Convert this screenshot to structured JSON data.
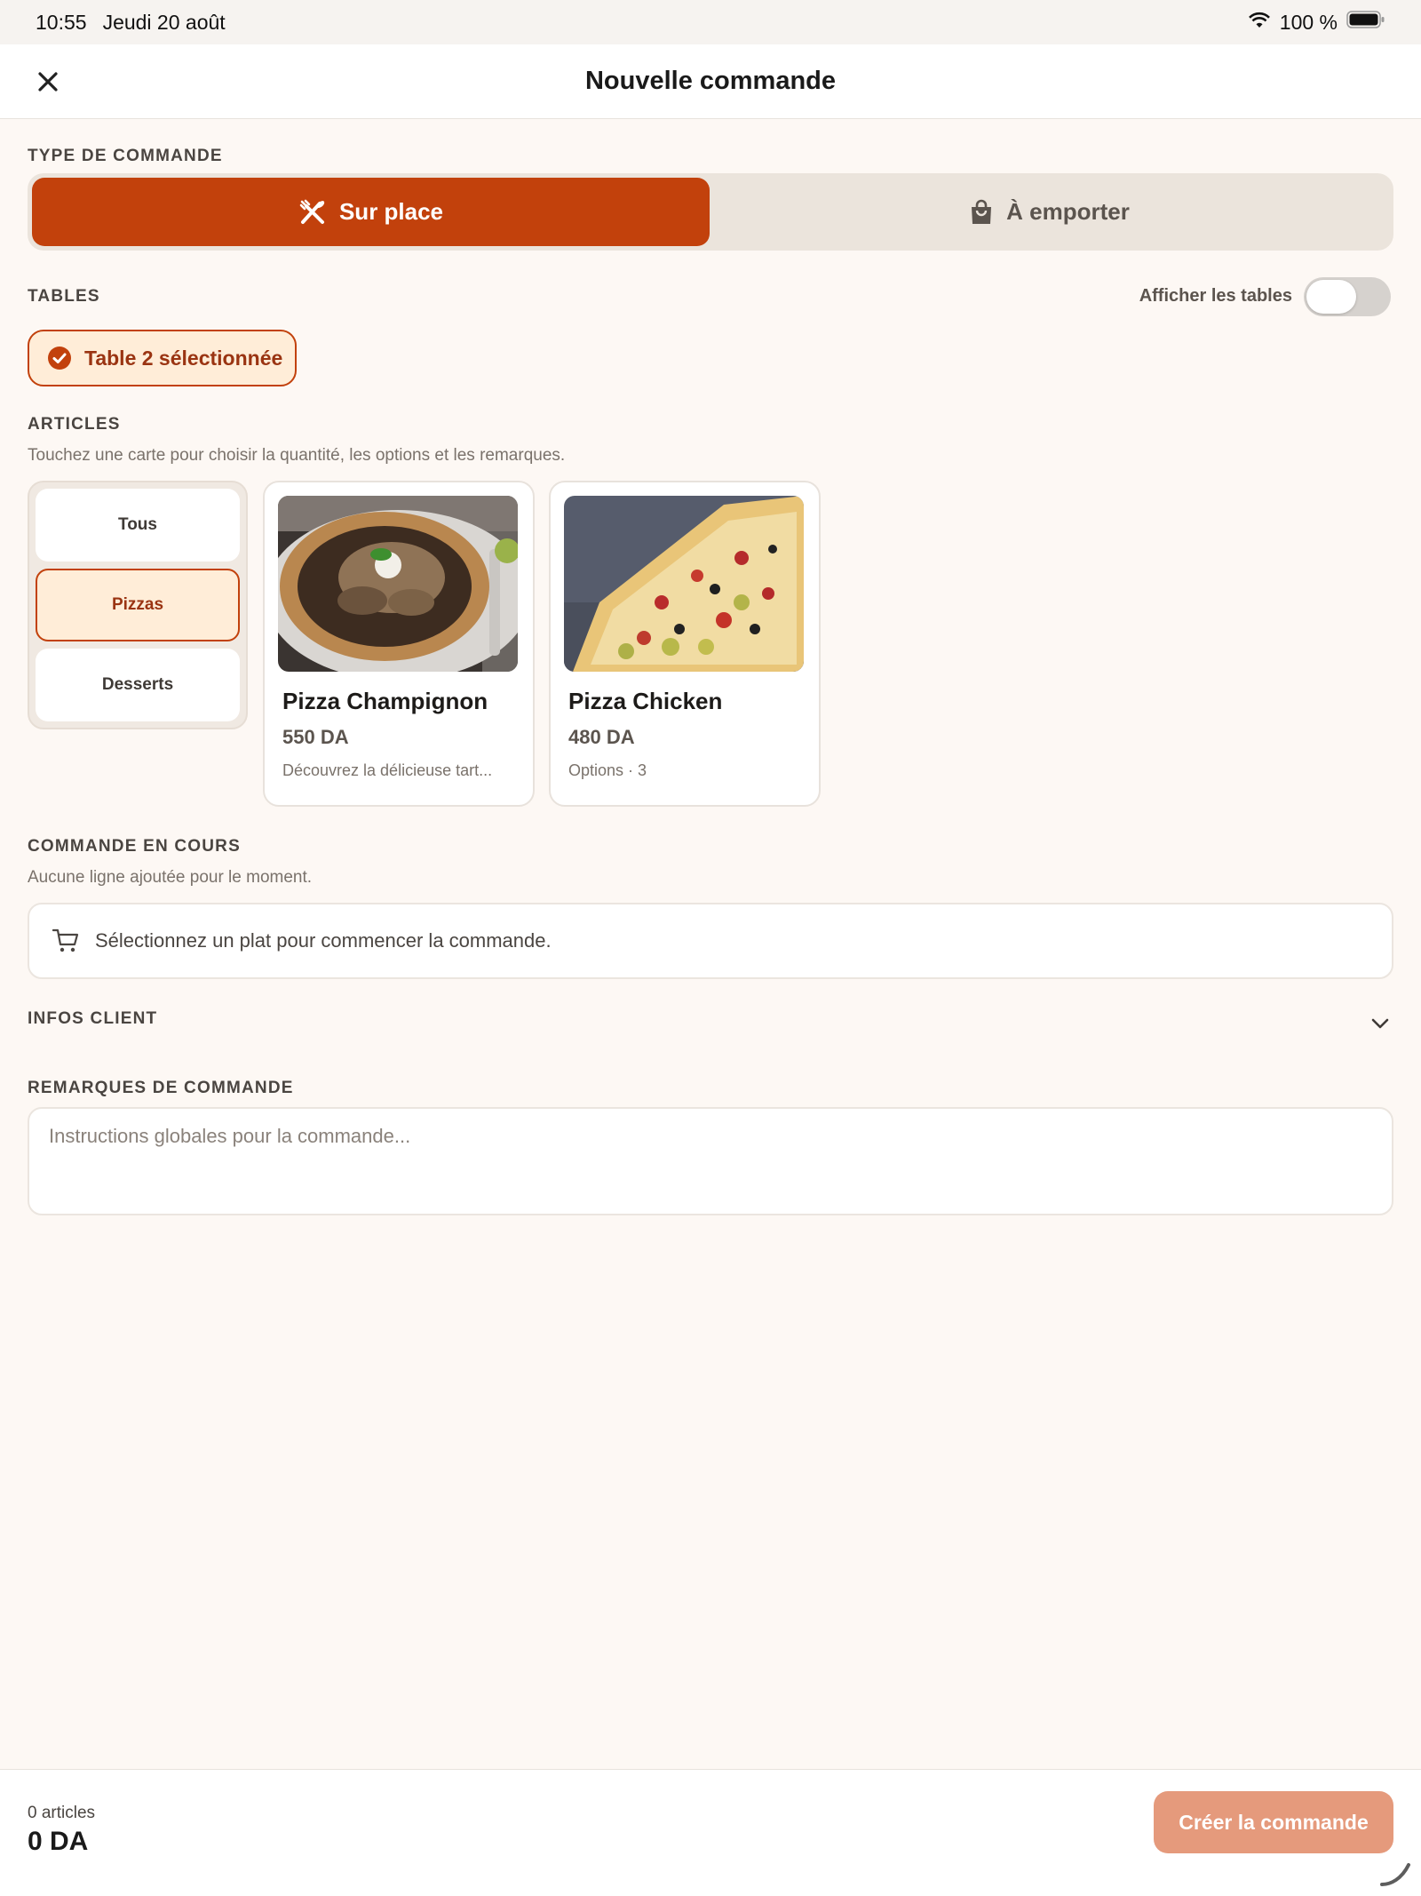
{
  "status_bar": {
    "time": "10:55",
    "date": "Jeudi 20 août",
    "battery": "100 %"
  },
  "header": {
    "title": "Nouvelle commande"
  },
  "order_type": {
    "label": "TYPE DE COMMANDE",
    "options": [
      {
        "label": "Sur place",
        "icon": "utensils-icon",
        "selected": true
      },
      {
        "label": "À emporter",
        "icon": "bag-icon",
        "selected": false
      }
    ]
  },
  "tables": {
    "label": "TABLES",
    "toggle_label": "Afficher les tables",
    "toggle_on": false,
    "selected_label": "Table 2 sélectionnée"
  },
  "articles": {
    "label": "ARTICLES",
    "hint": "Touchez une carte pour choisir la quantité, les options et les remarques.",
    "categories": [
      {
        "label": "Tous",
        "active": false
      },
      {
        "label": "Pizzas",
        "active": true
      },
      {
        "label": "Desserts",
        "active": false
      }
    ],
    "products": [
      {
        "name": "Pizza Champignon",
        "price": "550 DA",
        "subtitle": "Découvrez la délicieuse tart..."
      },
      {
        "name": "Pizza Chicken",
        "price": "480 DA",
        "subtitle": "Options · 3"
      }
    ]
  },
  "current_order": {
    "label": "COMMANDE EN COURS",
    "hint": "Aucune ligne ajoutée pour le moment.",
    "empty_text": "Sélectionnez un plat pour commencer la commande."
  },
  "client_info": {
    "label": "INFOS CLIENT"
  },
  "order_notes": {
    "label": "REMARQUES DE COMMANDE",
    "placeholder": "Instructions globales pour la commande..."
  },
  "footer": {
    "items_count": "0 articles",
    "total": "0 DA",
    "create_label": "Créer la commande"
  },
  "colors": {
    "accent": "#c2410c",
    "accent_light": "#ffedd8",
    "background": "#fdf8f4",
    "button_disabled": "#e59a7c"
  }
}
